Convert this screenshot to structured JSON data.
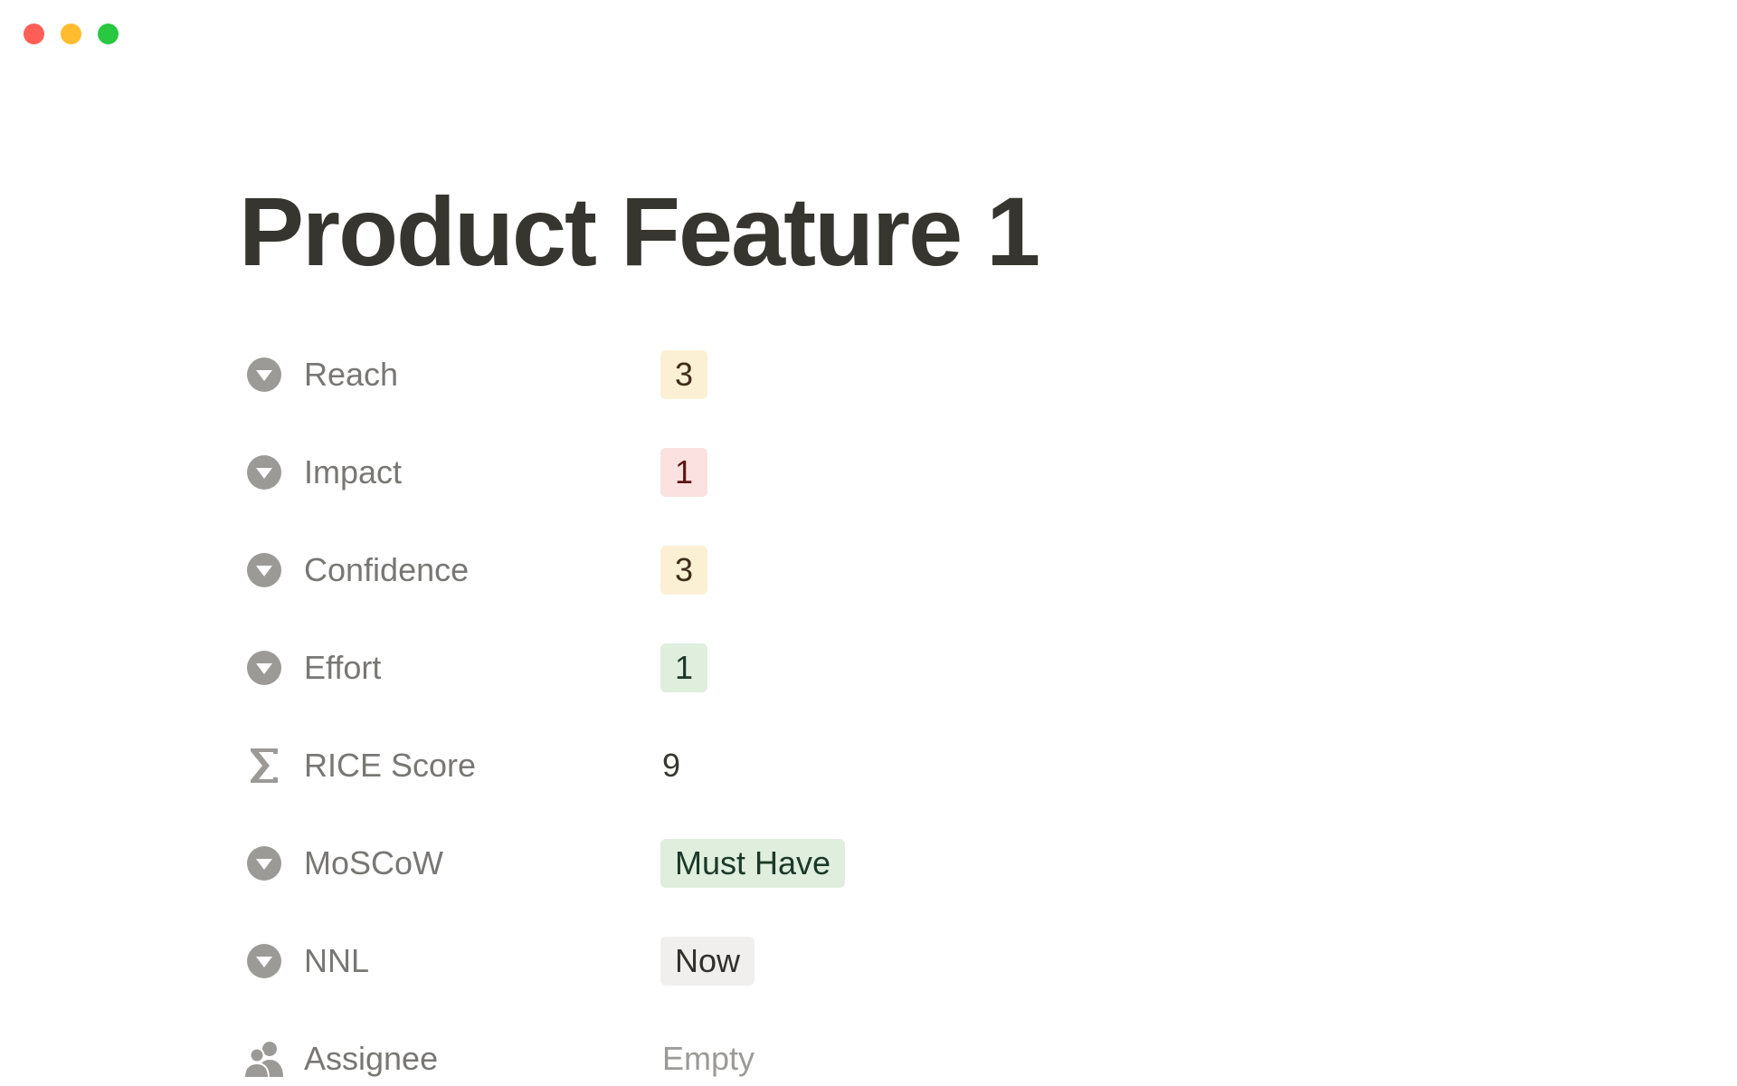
{
  "window": {
    "controls": [
      {
        "name": "close",
        "color": "#ff5f57"
      },
      {
        "name": "minimize",
        "color": "#febc2e"
      },
      {
        "name": "zoom",
        "color": "#28c840"
      }
    ]
  },
  "page": {
    "title": "Product Feature 1"
  },
  "properties": [
    {
      "key": "reach",
      "label": "Reach",
      "icon": "select-icon",
      "type": "select",
      "value": "3",
      "tag_bg": "#fbf0d4",
      "tag_fg": "#402c1b"
    },
    {
      "key": "impact",
      "label": "Impact",
      "icon": "select-icon",
      "type": "select",
      "value": "1",
      "tag_bg": "#fbe1df",
      "tag_fg": "#5d1715"
    },
    {
      "key": "confidence",
      "label": "Confidence",
      "icon": "select-icon",
      "type": "select",
      "value": "3",
      "tag_bg": "#fbf0d4",
      "tag_fg": "#402c1b"
    },
    {
      "key": "effort",
      "label": "Effort",
      "icon": "select-icon",
      "type": "select",
      "value": "1",
      "tag_bg": "#dfeedd",
      "tag_fg": "#1c3829"
    },
    {
      "key": "rice-score",
      "label": "RICE Score",
      "icon": "formula-sigma-icon",
      "type": "formula",
      "value": "9"
    },
    {
      "key": "moscow",
      "label": "MoSCoW",
      "icon": "select-icon",
      "type": "select",
      "value": "Must Have",
      "tag_bg": "#dfeedd",
      "tag_fg": "#1c3829"
    },
    {
      "key": "nnl",
      "label": "NNL",
      "icon": "select-icon",
      "type": "select",
      "value": "Now",
      "tag_bg": "#f0efed",
      "tag_fg": "#32302c"
    },
    {
      "key": "assignee",
      "label": "Assignee",
      "icon": "person-icon",
      "type": "person",
      "value": "Empty"
    }
  ]
}
